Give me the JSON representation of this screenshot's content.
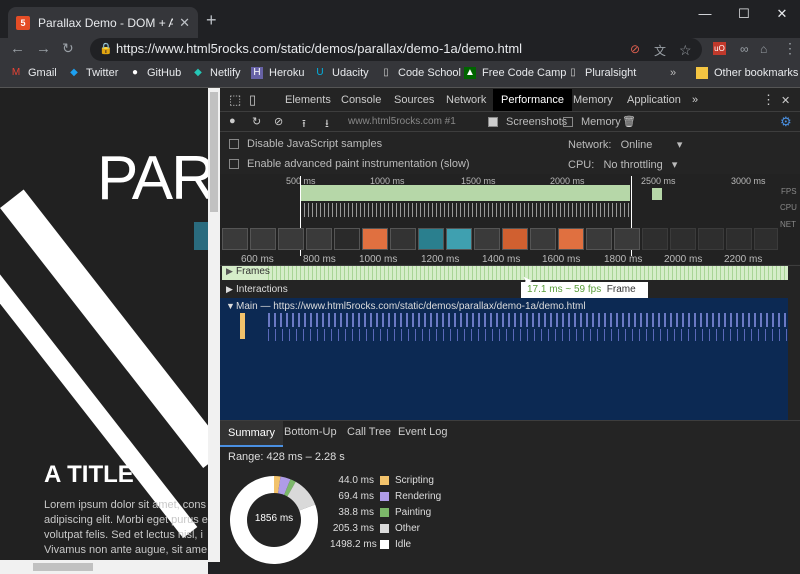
{
  "browser": {
    "tab_title": "Parallax Demo - DOM + Absolute",
    "tab_icon": "5",
    "url": "https://www.html5rocks.com/static/demos/parallax/demo-1a/demo.html",
    "bookmarks": [
      "Gmail",
      "Twitter",
      "GitHub",
      "Netlify",
      "Heroku",
      "Udacity",
      "Code School",
      "Free Code Camp",
      "Pluralsight"
    ],
    "other_bookmarks": "Other bookmarks",
    "more": "»"
  },
  "page": {
    "big_text": "PAR",
    "heading": "A TITLE",
    "lorem": [
      "Lorem ipsum dolor sit amet, cons",
      "adipiscing elit. Morbi eget purus e",
      "volutpat felis. Sed et lectus nisl, i",
      "Vivamus non ante augue, sit ame"
    ]
  },
  "devtools": {
    "tabs": [
      "Elements",
      "Console",
      "Sources",
      "Network",
      "Performance",
      "Memory",
      "Application"
    ],
    "more_tabs": "»",
    "recording_select": "www.html5rocks.com #1",
    "screenshots_label": "Screenshots",
    "memory_label": "Memory",
    "disable_js_label": "Disable JavaScript samples",
    "paint_label": "Enable advanced paint instrumentation (slow)",
    "network_label": "Network:",
    "network_value": "Online",
    "cpu_label": "CPU:",
    "cpu_value": "No throttling",
    "overview_ticks": [
      "500",
      "1000 ms",
      "1500 ms",
      "2000 ms",
      "2500 ms",
      "3000 ms"
    ],
    "overview_tick_ms": "ms",
    "track_labels": {
      "fps": "FPS",
      "cpu": "CPU",
      "net": "NET"
    },
    "ruler_ticks": [
      "600 ms",
      "800 ms",
      "1000 ms",
      "1200 ms",
      "1400 ms",
      "1600 ms",
      "1800 ms",
      "2000 ms",
      "2200 ms"
    ],
    "frames_label": "Frames",
    "interactions_label": "Interactions",
    "main_label": "Main — https://www.html5rocks.com/static/demos/parallax/demo-1a/demo.html",
    "tooltip_value": "17.1 ms ~ 59 fps",
    "tooltip_label": "Frame",
    "bottom_tabs": [
      "Summary",
      "Bottom-Up",
      "Call Tree",
      "Event Log"
    ],
    "range": "Range: 428 ms – 2.28 s",
    "total": "1856 ms",
    "summary": [
      {
        "value": "44.0 ms",
        "label": "Scripting",
        "color": "#f2c26b",
        "ms": 44.0
      },
      {
        "value": "69.4 ms",
        "label": "Rendering",
        "color": "#af9ce7",
        "ms": 69.4
      },
      {
        "value": "38.8 ms",
        "label": "Painting",
        "color": "#7cb86a",
        "ms": 38.8
      },
      {
        "value": "205.3 ms",
        "label": "Other",
        "color": "#d9d9d9",
        "ms": 205.3
      },
      {
        "value": "1498.2 ms",
        "label": "Idle",
        "color": "#ffffff",
        "ms": 1498.2
      }
    ]
  }
}
